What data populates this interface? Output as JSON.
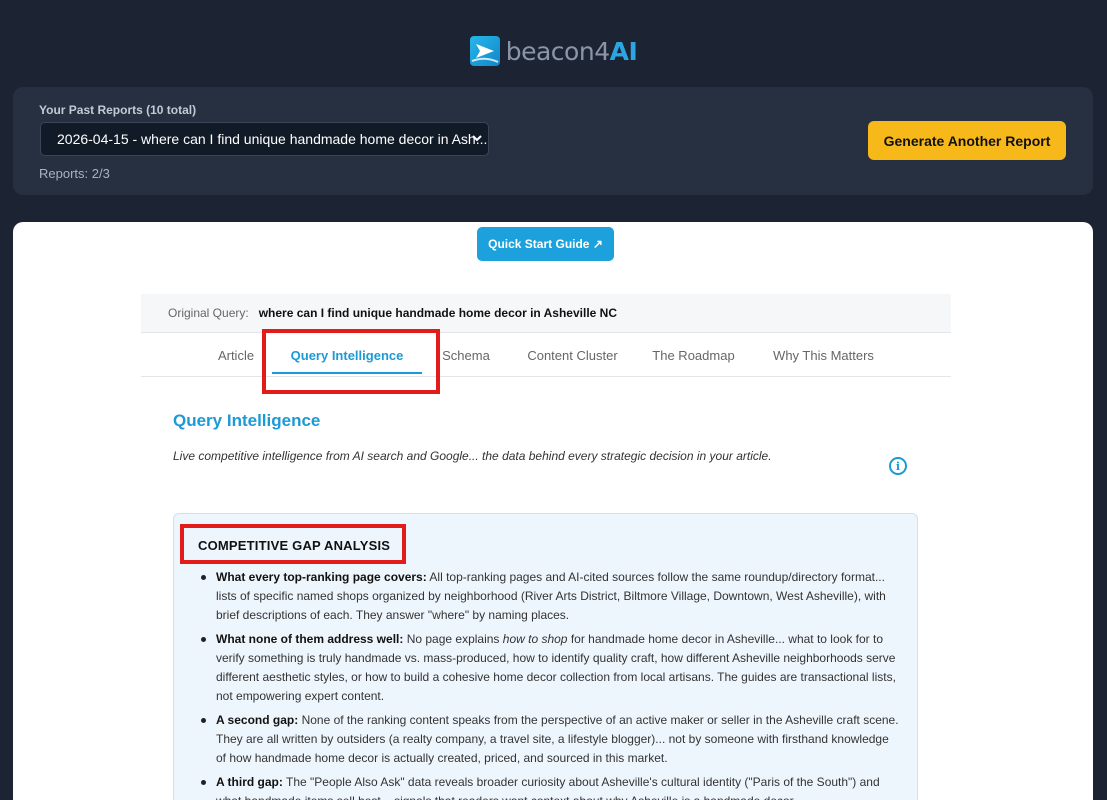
{
  "brand": {
    "name_prefix": "beacon4",
    "name_suffix": "AI"
  },
  "reports": {
    "label": "Your Past Reports (10 total)",
    "selected": "2026-04-15 - where can I find unique handmade home decor in Ash...",
    "count": "Reports: 2/3",
    "generate_button": "Generate Another Report"
  },
  "quick_start": "Quick Start Guide ↗",
  "query": {
    "label": "Original Query:",
    "value": "where can I find unique handmade home decor in Asheville NC"
  },
  "tabs": [
    {
      "label": "Article"
    },
    {
      "label": "Query Intelligence",
      "active": true
    },
    {
      "label": "Schema"
    },
    {
      "label": "Content Cluster"
    },
    {
      "label": "The Roadmap"
    },
    {
      "label": "Why This Matters"
    }
  ],
  "section": {
    "title": "Query Intelligence",
    "description": "Live competitive intelligence from AI search and Google... the data behind every strategic decision in your article.",
    "info_icon": "info-icon"
  },
  "gap_analysis": {
    "title": "COMPETITIVE GAP ANALYSIS",
    "items": [
      {
        "heading": "What every top-ranking page covers:",
        "text": " All top-ranking pages and AI-cited sources follow the same roundup/directory format... lists of specific named shops organized by neighborhood (River Arts District, Biltmore Village, Downtown, West Asheville), with brief descriptions of each. They answer \"where\" by naming places."
      },
      {
        "heading": "What none of them address well:",
        "text_before": " No page explains ",
        "emphasis": "how to shop",
        "text": " for handmade home decor in Asheville... what to look for to verify something is truly handmade vs. mass-produced, how to identify quality craft, how different Asheville neighborhoods serve different aesthetic styles, or how to build a cohesive home decor collection from local artisans. The guides are transactional lists, not empowering expert content."
      },
      {
        "heading": "A second gap:",
        "text": " None of the ranking content speaks from the perspective of an active maker or seller in the Asheville craft scene. They are all written by outsiders (a realty company, a travel site, a lifestyle blogger)... not by someone with firsthand knowledge of how handmade home decor is actually created, priced, and sourced in this market."
      },
      {
        "heading": "A third gap:",
        "text": " The \"People Also Ask\" data reveals broader curiosity about Asheville's cultural identity (\"Paris of the South\") and what handmade items sell best... signals that readers want context about why Asheville is a handmade decor"
      }
    ]
  },
  "colors": {
    "background": "#1c2433",
    "panel": "#263041",
    "accent": "#1c9ad6",
    "cta": "#f7b81a",
    "highlight": "#e21b1b"
  }
}
